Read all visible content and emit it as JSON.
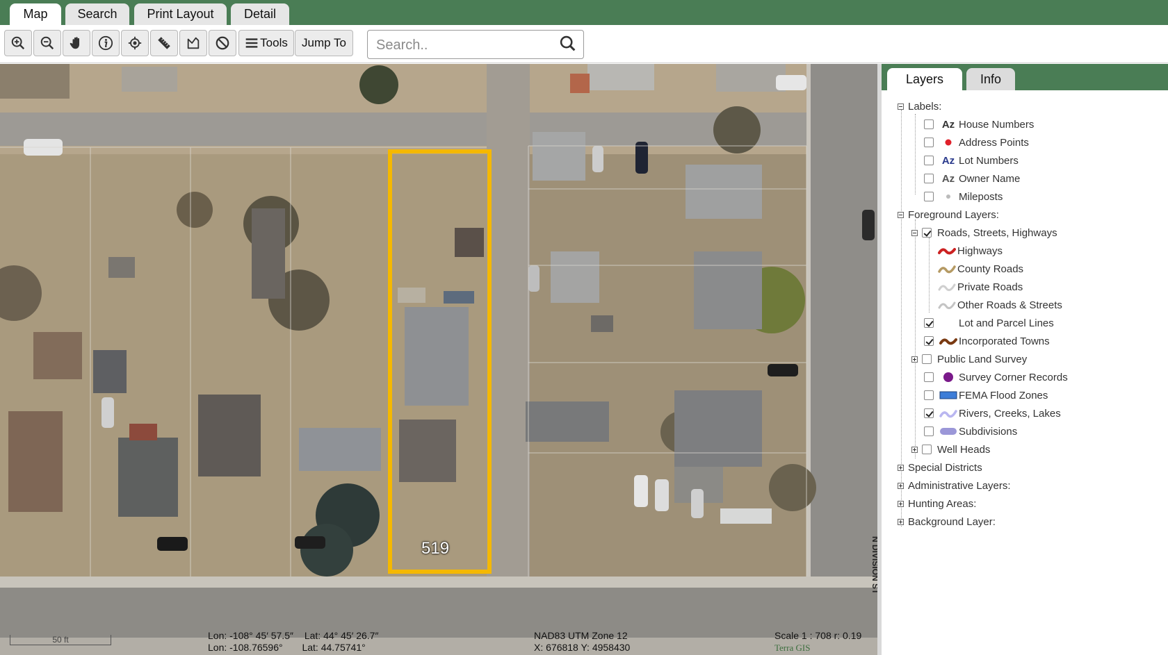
{
  "tabs": [
    {
      "label": "Map",
      "active": true
    },
    {
      "label": "Search",
      "active": false
    },
    {
      "label": "Print Layout",
      "active": false
    },
    {
      "label": "Detail",
      "active": false
    }
  ],
  "toolbar": {
    "icons": [
      "zoom-in-icon",
      "zoom-out-icon",
      "pan-hand-icon",
      "identify-info-icon",
      "locate-icon",
      "measure-ruler-icon",
      "select-area-icon",
      "clear-icon"
    ],
    "tools_label": "Tools",
    "jump_label": "Jump To",
    "search_placeholder": "Search.."
  },
  "map": {
    "lot_label": "519",
    "street_label": "N DIVISION ST",
    "scale_label": "50 ft",
    "coords_line1_lon": "Lon: -108° 45′ 57.5″",
    "coords_line1_lat": "Lat: 44° 45′ 26.7″",
    "coords_line2_lon": "Lon: -108.76596°",
    "coords_line2_lat": "Lat: 44.75741°",
    "utm_zone": "NAD83 UTM Zone 12",
    "utm_xy": "X: 676818 Y: 4958430",
    "scale_text": "Scale 1 : 708 r: 0.19",
    "brand": "Terra GIS",
    "highlight_color": "#f5b800"
  },
  "panel": {
    "tabs": [
      {
        "label": "Layers",
        "active": true
      },
      {
        "label": "Info",
        "active": false
      }
    ],
    "groups": {
      "labels": "Labels:",
      "foreground": "Foreground Layers:",
      "roads": "Roads, Streets, Highways",
      "special": "Special Districts",
      "administrative": "Administrative Layers:",
      "hunting": "Hunting Areas:",
      "background": "Background Layer:"
    },
    "label_layers": [
      {
        "label": "House Numbers",
        "checked": false,
        "symbol": "Az",
        "color": "#333333"
      },
      {
        "label": "Address Points",
        "checked": false,
        "symbol": "dot",
        "color": "#e0202a"
      },
      {
        "label": "Lot Numbers",
        "checked": false,
        "symbol": "Az",
        "color": "#2a3a8c"
      },
      {
        "label": "Owner Name",
        "checked": false,
        "symbol": "Az",
        "color": "#555555"
      },
      {
        "label": "Mileposts",
        "checked": false,
        "symbol": "smalldot",
        "color": "#aaaaaa"
      }
    ],
    "road_layers": [
      {
        "label": "Highways",
        "color": "#cc2222"
      },
      {
        "label": "County Roads",
        "color": "#b59a64"
      },
      {
        "label": "Private Roads",
        "color": "#cfcfcf"
      },
      {
        "label": "Other Roads & Streets",
        "color": "#c4c4c4"
      }
    ],
    "fg_layers": [
      {
        "label": "Lot and Parcel Lines",
        "checked": true,
        "symbol": "none",
        "color": "#ffffff"
      },
      {
        "label": "Incorporated Towns",
        "checked": true,
        "symbol": "wave",
        "color": "#7a3a12"
      },
      {
        "label": "Public Land Survey",
        "checked": false,
        "symbol": "none",
        "color": "#ffffff",
        "expand": true
      },
      {
        "label": "Survey Corner Records",
        "checked": false,
        "symbol": "circle",
        "color": "#7a1a8a"
      },
      {
        "label": "FEMA Flood Zones",
        "checked": false,
        "symbol": "rect",
        "color": "#3d7dd8"
      },
      {
        "label": "Rivers, Creeks, Lakes",
        "checked": true,
        "symbol": "wave",
        "color": "#b9b6f0"
      },
      {
        "label": "Subdivisions",
        "checked": false,
        "symbol": "pill",
        "color": "#9b97d8"
      },
      {
        "label": "Well Heads",
        "checked": false,
        "symbol": "none",
        "color": "#ffffff",
        "expand": true
      }
    ]
  }
}
